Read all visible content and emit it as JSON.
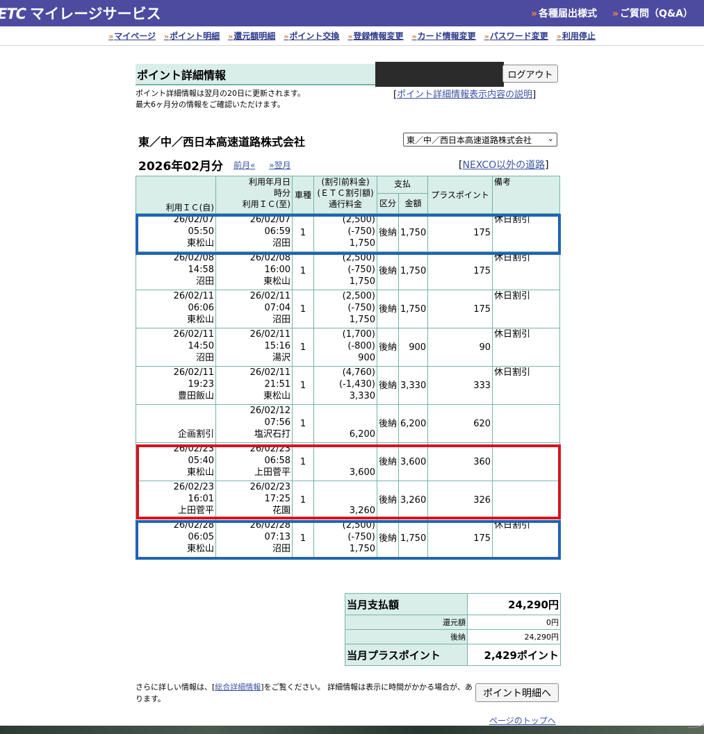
{
  "header": {
    "logo_mark": "ETC",
    "logo_text": "マイレージサービス",
    "links": [
      "各種届出様式",
      "ご質問（Q&A）"
    ]
  },
  "subnav": [
    "マイページ",
    "ポイント明細",
    "還元額明細",
    "ポイント交換",
    "登録情報変更",
    "カード情報変更",
    "パスワード変更",
    "利用停止"
  ],
  "page": {
    "title": "ポイント詳細情報",
    "logout": "ログアウト",
    "notice_line1": "ポイント詳細情報は翌月の20日に更新されます。",
    "notice_line2": "最大6ヶ月分の情報をご確認いただけます。",
    "explain_link": "ポイント詳細情報表示内容の説明",
    "company": "東／中／西日本高速道路株式会社",
    "company_select": "東／中／西日本高速道路株式会社",
    "month": "2026年02月分",
    "prev": "前月«",
    "next": "»翌月",
    "nexco_link": "NEXCO以外の道路"
  },
  "table": {
    "headers": {
      "entry_ic": "利用ＩＣ(自)",
      "datetime": "利用年月日",
      "time": "時分",
      "exit_ic": "利用ＩＣ(至)",
      "vehicle": "車種",
      "fee1": "(割引前料金)",
      "fee2": "(ＥＴＣ割引額)",
      "fee3": "通行料金",
      "payment": "支払",
      "pay_type": "区分",
      "pay_amount": "金額",
      "points": "プラスポイント",
      "remarks": "備考"
    },
    "rows": [
      {
        "d1": "26/02/07",
        "t1": "05:50",
        "ic1": "東松山",
        "d2": "26/02/07",
        "t2": "06:59",
        "ic2": "沼田",
        "vehicle": "1",
        "pre": "(2,500)",
        "disc": "(-750)",
        "fee": "1,750",
        "type": "後納",
        "amount": "1,750",
        "points": "175",
        "remarks": "休日割引"
      },
      {
        "d1": "26/02/08",
        "t1": "14:58",
        "ic1": "沼田",
        "d2": "26/02/08",
        "t2": "16:00",
        "ic2": "東松山",
        "vehicle": "1",
        "pre": "(2,500)",
        "disc": "(-750)",
        "fee": "1,750",
        "type": "後納",
        "amount": "1,750",
        "points": "175",
        "remarks": "休日割引"
      },
      {
        "d1": "26/02/11",
        "t1": "06:06",
        "ic1": "東松山",
        "d2": "26/02/11",
        "t2": "07:04",
        "ic2": "沼田",
        "vehicle": "1",
        "pre": "(2,500)",
        "disc": "(-750)",
        "fee": "1,750",
        "type": "後納",
        "amount": "1,750",
        "points": "175",
        "remarks": "休日割引"
      },
      {
        "d1": "26/02/11",
        "t1": "14:50",
        "ic1": "沼田",
        "d2": "26/02/11",
        "t2": "15:16",
        "ic2": "湯沢",
        "vehicle": "1",
        "pre": "(1,700)",
        "disc": "(-800)",
        "fee": "900",
        "type": "後納",
        "amount": "900",
        "points": "90",
        "remarks": "休日割引"
      },
      {
        "d1": "26/02/11",
        "t1": "19:23",
        "ic1": "豊田飯山",
        "d2": "26/02/11",
        "t2": "21:51",
        "ic2": "東松山",
        "vehicle": "1",
        "pre": "(4,760)",
        "disc": "(-1,430)",
        "fee": "3,330",
        "type": "後納",
        "amount": "3,330",
        "points": "333",
        "remarks": "休日割引"
      },
      {
        "d1": "",
        "t1": "",
        "ic1": "企画割引",
        "d2": "26/02/12",
        "t2": "07:56",
        "ic2": "塩沢石打",
        "vehicle": "1",
        "pre": "",
        "disc": "",
        "fee": "6,200",
        "type": "後納",
        "amount": "6,200",
        "points": "620",
        "remarks": ""
      },
      {
        "d1": "26/02/23",
        "t1": "05:40",
        "ic1": "東松山",
        "d2": "26/02/23",
        "t2": "06:58",
        "ic2": "上田菅平",
        "vehicle": "1",
        "pre": "",
        "disc": "",
        "fee": "3,600",
        "type": "後納",
        "amount": "3,600",
        "points": "360",
        "remarks": ""
      },
      {
        "d1": "26/02/23",
        "t1": "16:01",
        "ic1": "上田菅平",
        "d2": "26/02/23",
        "t2": "17:25",
        "ic2": "花園",
        "vehicle": "1",
        "pre": "",
        "disc": "",
        "fee": "3,260",
        "type": "後納",
        "amount": "3,260",
        "points": "326",
        "remarks": ""
      },
      {
        "d1": "26/02/28",
        "t1": "06:05",
        "ic1": "東松山",
        "d2": "26/02/28",
        "t2": "07:13",
        "ic2": "沼田",
        "vehicle": "1",
        "pre": "(2,500)",
        "disc": "(-750)",
        "fee": "1,750",
        "type": "後納",
        "amount": "1,750",
        "points": "175",
        "remarks": "休日割引"
      }
    ]
  },
  "summary": {
    "total_label": "当月支払額",
    "total_value": "24,290円",
    "refund_label": "還元額",
    "refund_value": "0円",
    "postpaid_label": "後納",
    "postpaid_value": "24,290円",
    "points_label": "当月プラスポイント",
    "points_value": "2,429ポイント"
  },
  "footer": {
    "text_before": "さらに詳しい情報は、[",
    "link": "総合詳細情報",
    "text_after": "]をご覧ください。 詳細情報は表示に時間がかかる場合が、あります。",
    "detail_button": "ポイント明細へ",
    "pagetop": "ページのトップへ"
  },
  "colors": {
    "header_bg": "#4d4ba0",
    "table_header_bg": "#d9ede9",
    "table_border": "#74b3a8",
    "highlight_blue": "#1f64b3",
    "highlight_red": "#d8131f"
  }
}
